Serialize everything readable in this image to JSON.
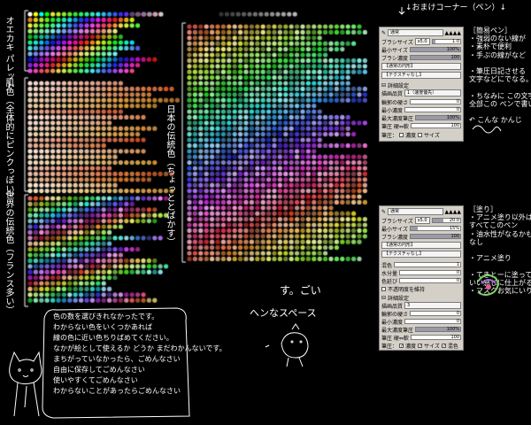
{
  "palette_sections": {
    "oekaki_palette": "オエカキ\nパレット",
    "skin": "肌色（全体的にピンクっぽい）",
    "world_traditional": "世界の伝統色（フランス多い）",
    "japan_traditional": "日本の伝統色（ちょっととばかす）"
  },
  "header_note": "↓おまけコーナー（ペン）↓",
  "panel_top": {
    "mode": "通常",
    "brush_size_label": "ブラシサイズ",
    "brush_size_multiplier": "x5.0",
    "brush_size_value": "1.0",
    "min_size_label": "最小サイズ",
    "min_size_value": "100%",
    "brush_density_label": "ブラシ濃度",
    "brush_density_value": "100",
    "edge_label": "【通常の円形】",
    "texture_label": "【テクスチャなし】",
    "detail_label": "詳細設定",
    "quality_label": "描画品質",
    "quality_value": "1（速度優先）",
    "edge_hardness_label": "輪郭の硬さ",
    "edge_hardness_value": "0",
    "min_density_label": "最小濃度",
    "min_density_value": "0",
    "max_density_pressure_label": "最大濃度筆圧",
    "max_density_pressure_value": "100%",
    "pressure_label": "筆圧 硬⇔軟",
    "pressure_value": "100",
    "pressure_check_label": "筆圧：",
    "pressure_density": "濃度",
    "pressure_size": "サイズ"
  },
  "panel_bottom": {
    "mode": "通常",
    "brush_size_label": "ブラシサイズ",
    "brush_size_multiplier": "x5.0",
    "brush_size_value": "20.0",
    "min_size_label": "最小サイズ",
    "min_size_value": "15%",
    "brush_density_label": "ブラシ濃度",
    "brush_density_value": "100",
    "edge_label": "【通常の円形】",
    "texture_label": "【テクスチャなし】",
    "mix_label": "混色",
    "mix_value": "1",
    "water_label": "水分量",
    "water_value": "0",
    "stretch_label": "色延び",
    "stretch_value": "0",
    "keep_opacity_label": "不透明度を維持",
    "detail_label": "詳細設定",
    "quality_label": "描画品質",
    "quality_value": "3",
    "edge_hardness_label": "輪郭の硬さ",
    "edge_hardness_value": "0",
    "min_density_label": "最小濃度",
    "min_density_value": "0",
    "max_density_pressure_label": "最大濃度筆圧",
    "max_density_pressure_value": "100%",
    "pressure_label": "筆圧 硬⇔軟",
    "pressure_value": "100",
    "pressure_check_label": "筆圧：",
    "pressure_density": "濃度",
    "pressure_size": "サイズ",
    "pressure_mix": "混色"
  },
  "notes_top": {
    "title": "［簡易ペン］",
    "lines": [
      "・強弱のない線が",
      "・素朴で便利",
      "・手ぶの線がなど",
      "",
      "・筆圧日記させる",
      "文字などにでなる。",
      "",
      "・ちなみに この文字",
      "全部この ペンで書いた",
      "",
      "↶ こんな かんじ"
    ]
  },
  "notes_bottom": {
    "title": "［塗り］",
    "lines": [
      "・アニメ塗り以外は",
      "すべてこのペン",
      "・油水性がなるかも",
      "なし",
      "",
      "・アニメ塗り",
      "",
      "・てきとーに塗っても",
      "いい感じに仕上がるよ",
      "・マスクお気にいり"
    ]
  },
  "center_note": {
    "line1": "す。ごい",
    "line2": "へンなスペース"
  },
  "bottom_note": {
    "lines": [
      "色の数を選びきれなかったです。",
      "わからない色をいくつかあれば",
      "線の色に近い色ちりばめてください。",
      "なかが絵として使えるか どうか まだわかんないです。",
      "まちがっていなかったら、ごめんなさい",
      "自由に保存してごめんなさい",
      "使いやすくてごめんなさい",
      "わからないことがあったらごめんなさい"
    ]
  },
  "colors": {
    "background": "#000000",
    "panel_bg": "#d4d0c8"
  }
}
